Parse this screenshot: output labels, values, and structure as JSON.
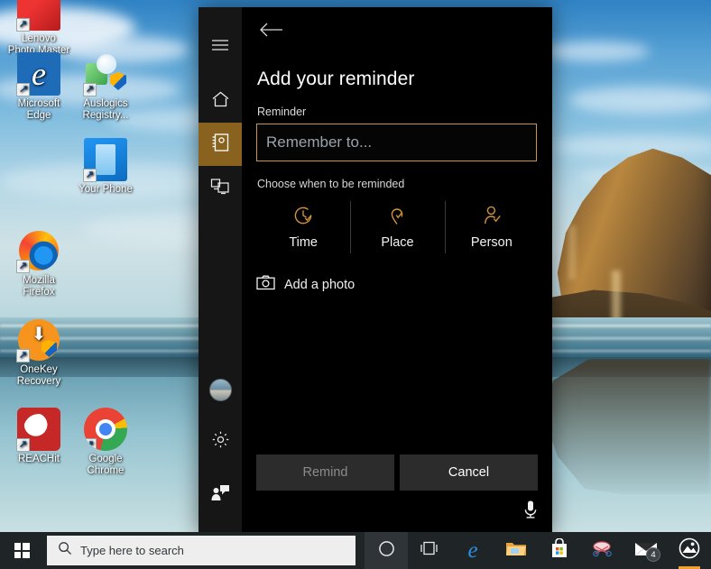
{
  "desktop": {
    "icons": [
      {
        "label": "Lenovo\nPhoto Master",
        "name": "desktop-icon-lenovo-photo-master",
        "icon": "lenovo-photo-master-icon"
      },
      {
        "label": "Microsoft\nEdge",
        "name": "desktop-icon-microsoft-edge",
        "icon": "edge-icon"
      },
      {
        "label": "Auslogics\nRegistry...",
        "name": "desktop-icon-auslogics-registry",
        "icon": "auslogics-registry-icon"
      },
      {
        "label": "Your Phone",
        "name": "desktop-icon-your-phone",
        "icon": "your-phone-icon"
      },
      {
        "label": "Mozilla\nFirefox",
        "name": "desktop-icon-mozilla-firefox",
        "icon": "firefox-icon"
      },
      {
        "label": "OneKey\nRecovery",
        "name": "desktop-icon-onekey-recovery",
        "icon": "onekey-recovery-icon"
      },
      {
        "label": "REACHit",
        "name": "desktop-icon-reachit",
        "icon": "reachit-icon"
      },
      {
        "label": "Google\nChrome",
        "name": "desktop-icon-google-chrome",
        "icon": "chrome-icon"
      }
    ]
  },
  "cortana": {
    "rail": {
      "hamburger": "hamburger-icon",
      "home": "home-icon",
      "notebook": "notebook-icon",
      "devices": "devices-icon",
      "avatar": "user-avatar",
      "settings": "gear-icon",
      "feedback": "feedback-icon"
    },
    "back_label": "←",
    "title": "Add your reminder",
    "reminder_label": "Reminder",
    "reminder_value": "",
    "reminder_placeholder": "Remember to...",
    "choose_label": "Choose when to be reminded",
    "choices": [
      {
        "label": "Time",
        "icon": "clock-check-icon"
      },
      {
        "label": "Place",
        "icon": "map-pin-check-icon"
      },
      {
        "label": "Person",
        "icon": "person-check-icon"
      }
    ],
    "add_photo_label": "Add a photo",
    "add_photo_icon": "camera-icon",
    "remind_label": "Remind",
    "cancel_label": "Cancel",
    "mic_icon": "microphone-icon",
    "accent_color": "#8a6220",
    "input_border_color": "#c79648"
  },
  "taskbar": {
    "start_icon": "windows-start-icon",
    "search_placeholder": "Type here to search",
    "search_icon": "search-icon",
    "buttons": [
      {
        "name": "cortana-button",
        "icon": "cortana-circle-icon",
        "badge": ""
      },
      {
        "name": "task-view-button",
        "icon": "task-view-icon",
        "badge": ""
      },
      {
        "name": "edge-taskbar-button",
        "icon": "edge-icon",
        "badge": ""
      },
      {
        "name": "file-explorer-button",
        "icon": "folder-icon",
        "badge": ""
      },
      {
        "name": "microsoft-store-button",
        "icon": "store-bag-icon",
        "badge": ""
      },
      {
        "name": "snipping-tool-button",
        "icon": "snip-scissors-icon",
        "badge": ""
      },
      {
        "name": "mail-button",
        "icon": "mail-envelope-icon",
        "badge": "4"
      },
      {
        "name": "photos-button",
        "icon": "photos-icon",
        "badge": ""
      }
    ]
  }
}
